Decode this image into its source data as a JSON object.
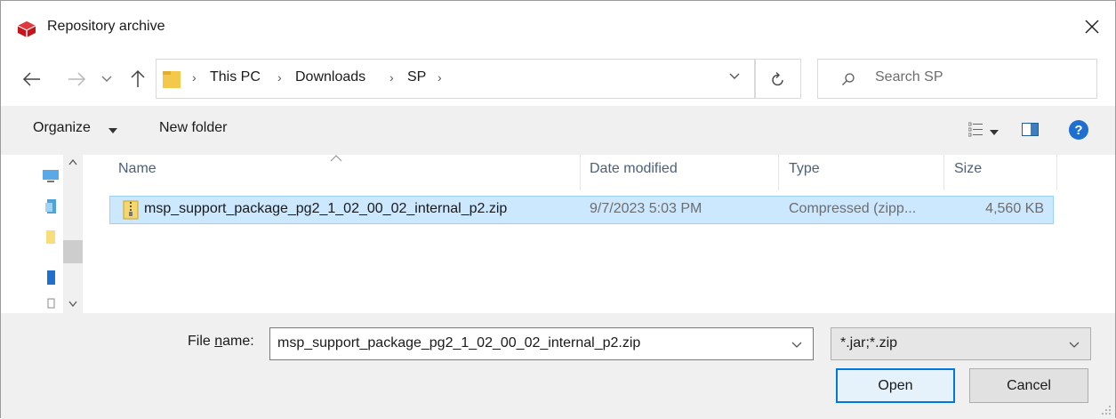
{
  "window": {
    "title": "Repository archive",
    "colors": {
      "accent": "#0078d7",
      "selection": "#cce8ff",
      "app_icon": "#c4151c",
      "folder": "#f2c94c"
    }
  },
  "nav": {
    "crumbs": [
      "This PC",
      "Downloads",
      "SP"
    ],
    "search_placeholder": "Search SP"
  },
  "toolbar": {
    "organize_label": "Organize",
    "new_folder_label": "New folder"
  },
  "columns": [
    "Name",
    "Date modified",
    "Type",
    "Size"
  ],
  "files": [
    {
      "name": "msp_support_package_pg2_1_02_00_02_internal_p2.zip",
      "date_modified": "9/7/2023 5:03 PM",
      "type": "Compressed (zipp...",
      "size": "4,560 KB",
      "selected": true
    }
  ],
  "footer": {
    "file_name_label_pre": "File ",
    "file_name_label_mnemonic": "n",
    "file_name_label_post": "ame:",
    "file_name_value": "msp_support_package_pg2_1_02_00_02_internal_p2.zip",
    "file_type_value": "*.jar;*.zip",
    "open_label": "Open",
    "cancel_label": "Cancel"
  },
  "icons": [
    "app-icon",
    "close-icon",
    "back-arrow-icon",
    "forward-arrow-icon",
    "recent-locations-chevron-icon",
    "up-arrow-icon",
    "folder-icon",
    "chevron-down-icon",
    "refresh-icon",
    "search-icon",
    "view-options-icon",
    "preview-pane-icon",
    "help-icon",
    "zip-file-icon"
  ]
}
